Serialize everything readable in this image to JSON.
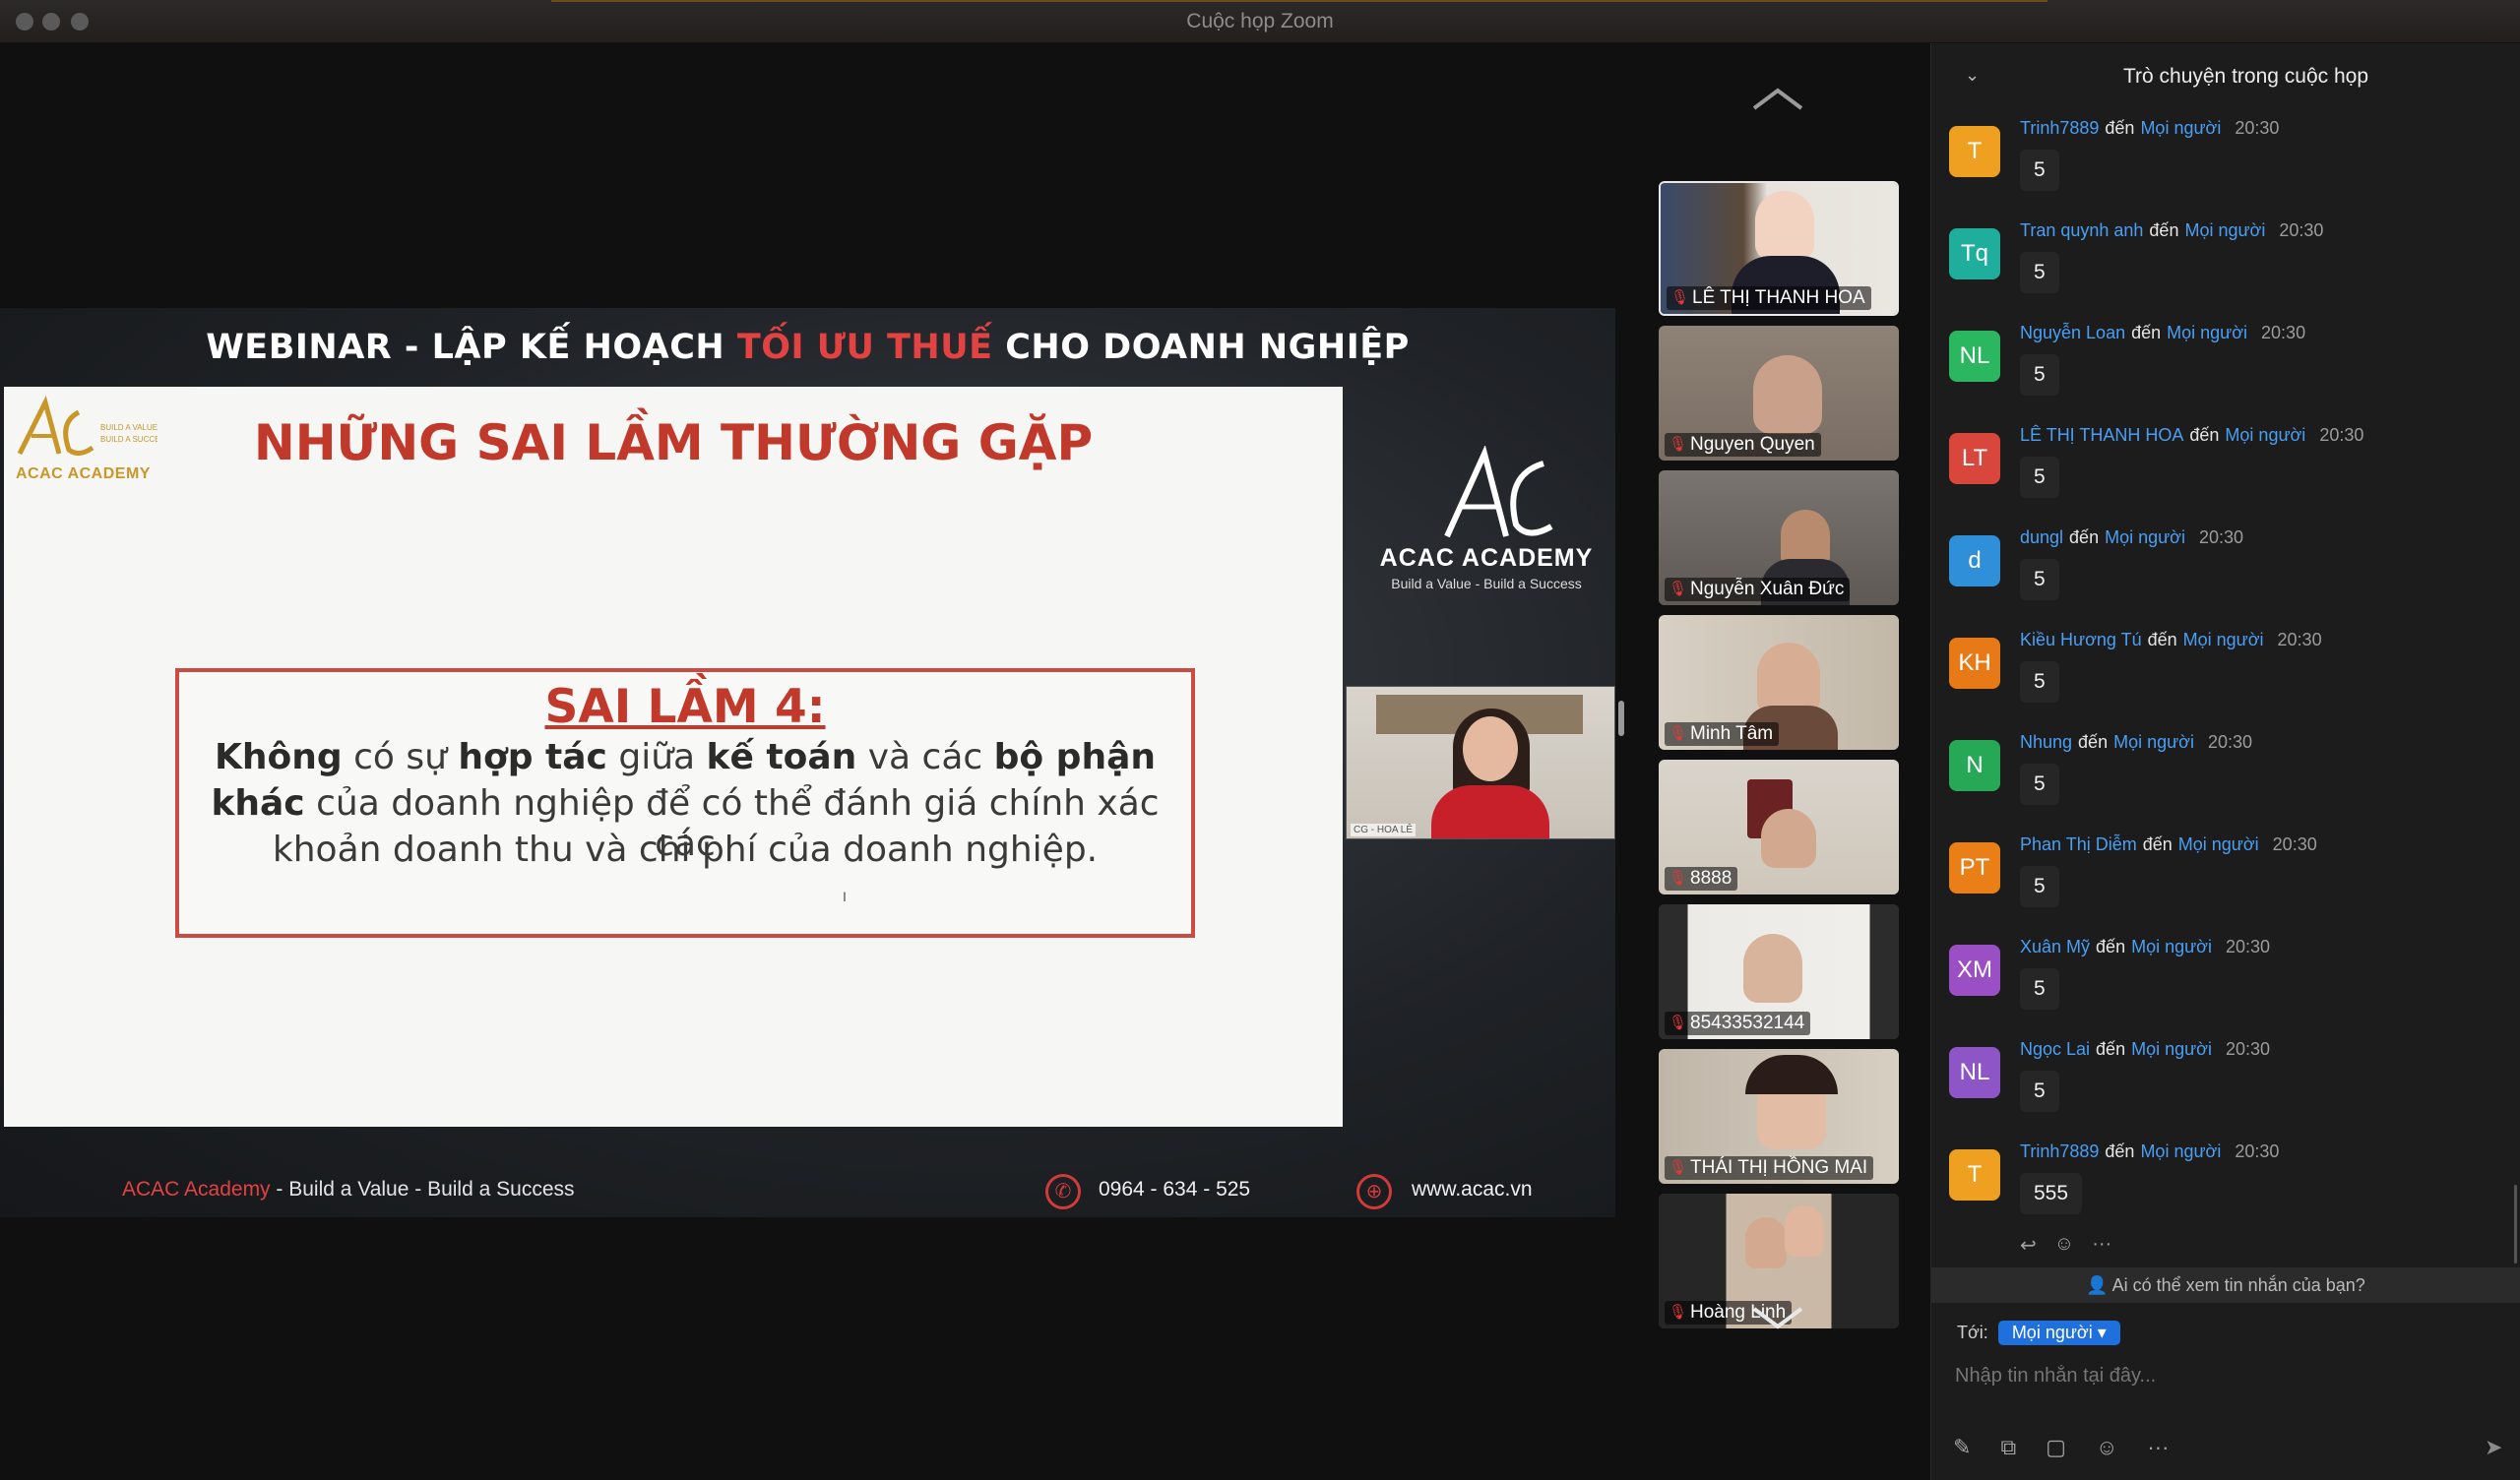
{
  "window": {
    "title": "Cuộc họp Zoom"
  },
  "slide": {
    "header_part1": "WEBINAR - LẬP KẾ HOẠCH ",
    "header_red": "TỐI ƯU THUẾ",
    "header_part2": " CHO DOANH NGHIỆP",
    "logo_text": "ACAC ACADEMY",
    "title": "NHỮNG SAI LẦM THƯỜNG GẶP",
    "box_title": "SAI LẦM 4:",
    "line1_b1": "Không",
    "line1_t1": " có sự ",
    "line1_b2": "hợp tác",
    "line1_t2": " giữa ",
    "line1_b3": "kế toán",
    "line1_t3": " và các ",
    "line1_b4": "bộ phận",
    "line2_b1": "khác",
    "line2_t1": " của doanh nghiệp để có thể đánh giá chính xác các",
    "line3": "khoản doanh thu và chi phí của doanh nghiệp.",
    "brand_name": "ACAC ACADEMY",
    "brand_tagline": "Build a Value - Build a Success",
    "presenter_label": "CG - HOA LÊ",
    "footer_brand": "ACAC Academy",
    "footer_tagline": " - Build a Value - Build a Success",
    "footer_phone": "0964 - 634 - 525",
    "footer_web": "www.acac.vn"
  },
  "participants": [
    {
      "name": "LÊ THỊ THANH HOA",
      "active": true
    },
    {
      "name": "Nguyen Quyen"
    },
    {
      "name": "Nguyễn Xuân Đức"
    },
    {
      "name": "Minh Tâm"
    },
    {
      "name": "8888"
    },
    {
      "name": "85433532144"
    },
    {
      "name": "THÁI THỊ HỒNG MAI"
    },
    {
      "name": "Hoàng Linh"
    }
  ],
  "chat": {
    "title": "Trò chuyện trong cuộc họp",
    "to_word": "đến",
    "messages": [
      {
        "initials": "T",
        "color": "#f0a020",
        "sender": "Trinh7889",
        "recipient": "Mọi người",
        "time": "20:30",
        "text": "5"
      },
      {
        "initials": "Tq",
        "color": "#1fae9c",
        "sender": "Tran quynh anh",
        "recipient": "Mọi người",
        "time": "20:30",
        "text": "5"
      },
      {
        "initials": "NL",
        "color": "#2bb760",
        "sender": "Nguyễn Loan",
        "recipient": "Mọi người",
        "time": "20:30",
        "text": "5"
      },
      {
        "initials": "LT",
        "color": "#d9463c",
        "sender": "LÊ THỊ THANH HOA",
        "recipient": "Mọi người",
        "time": "20:30",
        "text": "5"
      },
      {
        "initials": "d",
        "color": "#2f8fd8",
        "sender": "dungl",
        "recipient": "Mọi người",
        "time": "20:30",
        "text": "5"
      },
      {
        "initials": "KH",
        "color": "#e77a16",
        "sender": "Kiều Hương Tú",
        "recipient": "Mọi người",
        "time": "20:30",
        "text": "5"
      },
      {
        "initials": "N",
        "color": "#27a856",
        "sender": "Nhung",
        "recipient": "Mọi người",
        "time": "20:30",
        "text": "5"
      },
      {
        "initials": "PT",
        "color": "#ea7f18",
        "sender": "Phan Thị Diễm",
        "recipient": "Mọi người",
        "time": "20:30",
        "text": "5"
      },
      {
        "initials": "XM",
        "color": "#9b4fc4",
        "sender": "Xuân Mỹ",
        "recipient": "Mọi người",
        "time": "20:30",
        "text": "5"
      },
      {
        "initials": "NL",
        "color": "#8d55c6",
        "sender": "Ngọc Lai",
        "recipient": "Mọi người",
        "time": "20:30",
        "text": "5"
      },
      {
        "initials": "T",
        "color": "#f0a020",
        "sender": "Trinh7889",
        "recipient": "Mọi người",
        "time": "20:30",
        "text": "555"
      }
    ],
    "visibility_note": "Ai có thể xem tin nhắn của bạn?",
    "to_label": "Tới:",
    "to_value": "Mọi người",
    "input_placeholder": "Nhập tin nhắn tại đây..."
  },
  "icons": {
    "chat_collapse": "chevron-down-icon",
    "gallery_up": "chevron-up-icon",
    "gallery_down": "chevron-down-icon",
    "muted": "mic-muted-icon",
    "reply": "reply-icon",
    "react": "emoji-icon",
    "more": "more-icon",
    "format": "format-icon",
    "screenshot": "screenshot-icon",
    "file": "file-icon",
    "emoji": "emoji-icon",
    "send": "send-icon"
  }
}
